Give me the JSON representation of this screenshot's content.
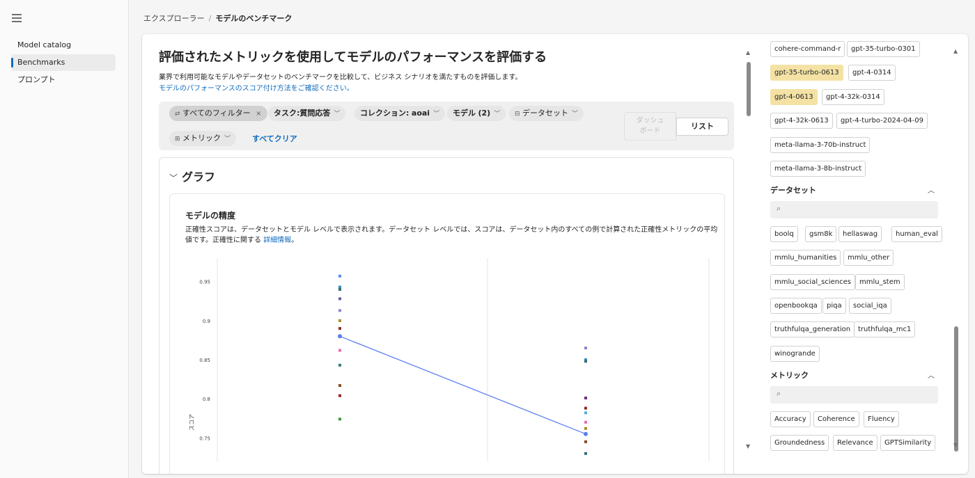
{
  "nav": {
    "items": [
      "Model catalog",
      "Benchmarks",
      "プロンプト"
    ]
  },
  "breadcrumb": {
    "root": "エクスプローラー",
    "sep": "/",
    "current": "モデルのベンチマーク"
  },
  "header": {
    "title": "評価されたメトリックを使用してモデルのパフォーマンスを評価する",
    "subtitle": "業界で利用可能なモデルやデータセットのベンチマークを比較して、ビジネス シナリオを満たすものを評価します。",
    "link": "モデルのパフォーマンスのスコア付け方法をご確認ください。"
  },
  "filters": {
    "all": "すべてのフィルター",
    "task_prefix": "タスク:",
    "task_value": "質問応答",
    "collection_prefix": "コレクション:",
    "collection_value": "aoai",
    "model_label": "モデル",
    "model_count": "(2)",
    "dataset": "データセット",
    "metric": "メトリック",
    "clear_all": "すべてクリア"
  },
  "view": {
    "dashboard_line1": "ダッシュ",
    "dashboard_line2": "ボード",
    "list": "リスト"
  },
  "graph": {
    "section_title": "グラフ",
    "card_title": "モデルの精度",
    "desc": "正確性スコアは、データセットとモデル レベルで表示されます。データセット レベルでは、スコアは、データセット内のすべての例で計算された正確性メトリックの平均値です。正確性に関する",
    "desc_link": "詳細情報",
    "desc_end": "。"
  },
  "chart_data": {
    "type": "scatter",
    "ylabel": "スコア",
    "yticks": [
      "0.95",
      "0.9",
      "0.85",
      "0.8",
      "0.75"
    ],
    "ylim": [
      0.72,
      0.98
    ],
    "grid": true,
    "groups": [
      {
        "points": [
          {
            "y": 0.957,
            "color": "#5b8def"
          },
          {
            "y": 0.943,
            "color": "#3a8fc4"
          },
          {
            "y": 0.94,
            "color": "#2f6e7c"
          },
          {
            "y": 0.928,
            "color": "#6d5bab"
          },
          {
            "y": 0.913,
            "color": "#9a7fd6"
          },
          {
            "y": 0.9,
            "color": "#b08a2e"
          },
          {
            "y": 0.89,
            "color": "#8b2e2e"
          },
          {
            "y": 0.862,
            "color": "#e66fb5"
          },
          {
            "y": 0.843,
            "color": "#2f7f7a"
          },
          {
            "y": 0.817,
            "color": "#8a4b2a"
          },
          {
            "y": 0.804,
            "color": "#a12525"
          },
          {
            "y": 0.774,
            "color": "#3a9a3a"
          }
        ],
        "mean": 0.88
      },
      {
        "points": [
          {
            "y": 0.865,
            "color": "#8e84c8"
          },
          {
            "y": 0.85,
            "color": "#3a8fc4"
          },
          {
            "y": 0.848,
            "color": "#2f6e7c"
          },
          {
            "y": 0.801,
            "color": "#6b2f7a"
          },
          {
            "y": 0.788,
            "color": "#8b2e2e"
          },
          {
            "y": 0.782,
            "color": "#4bb0d8"
          },
          {
            "y": 0.77,
            "color": "#e66fb5"
          },
          {
            "y": 0.762,
            "color": "#b08a2e"
          },
          {
            "y": 0.745,
            "color": "#8a4b2a"
          },
          {
            "y": 0.73,
            "color": "#2f6e7c"
          }
        ],
        "mean": 0.755
      }
    ],
    "mean_line_color": "#5b7ff0"
  },
  "right_panel": {
    "models": [
      {
        "label": "cohere-command-r",
        "hl": false
      },
      {
        "label": "gpt-35-turbo-0301",
        "hl": false
      },
      {
        "label": "gpt-35-turbo-0613",
        "hl": true
      },
      {
        "label": "gpt-4-0314",
        "hl": false
      },
      {
        "label": "gpt-4-0613",
        "hl": true
      },
      {
        "label": "gpt-4-32k-0314",
        "hl": false
      },
      {
        "label": "gpt-4-32k-0613",
        "hl": false
      },
      {
        "label": "gpt-4-turbo-2024-04-09",
        "hl": false
      },
      {
        "label": "meta-llama-3-70b-instruct",
        "hl": false
      },
      {
        "label": "meta-llama-3-8b-instruct",
        "hl": false
      }
    ],
    "dataset_title": "データセット",
    "datasets": [
      "boolq",
      "gsm8k",
      "hellaswag",
      "human_eval",
      "mmlu_humanities",
      "mmlu_other",
      "mmlu_social_sciences",
      "mmlu_stem",
      "openbookqa",
      "piqa",
      "social_iqa",
      "truthfulqa_generation",
      "truthfulqa_mc1",
      "winogrande"
    ],
    "metric_title": "メトリック",
    "metrics": [
      "Accuracy",
      "Coherence",
      "Fluency",
      "Groundedness",
      "Relevance",
      "GPTSimilarity"
    ]
  },
  "icons": {
    "menu": "hamburger-icon",
    "search": "search-icon",
    "filter": "filter-icon",
    "database": "database-icon",
    "chevron": "chevron-down-icon"
  }
}
